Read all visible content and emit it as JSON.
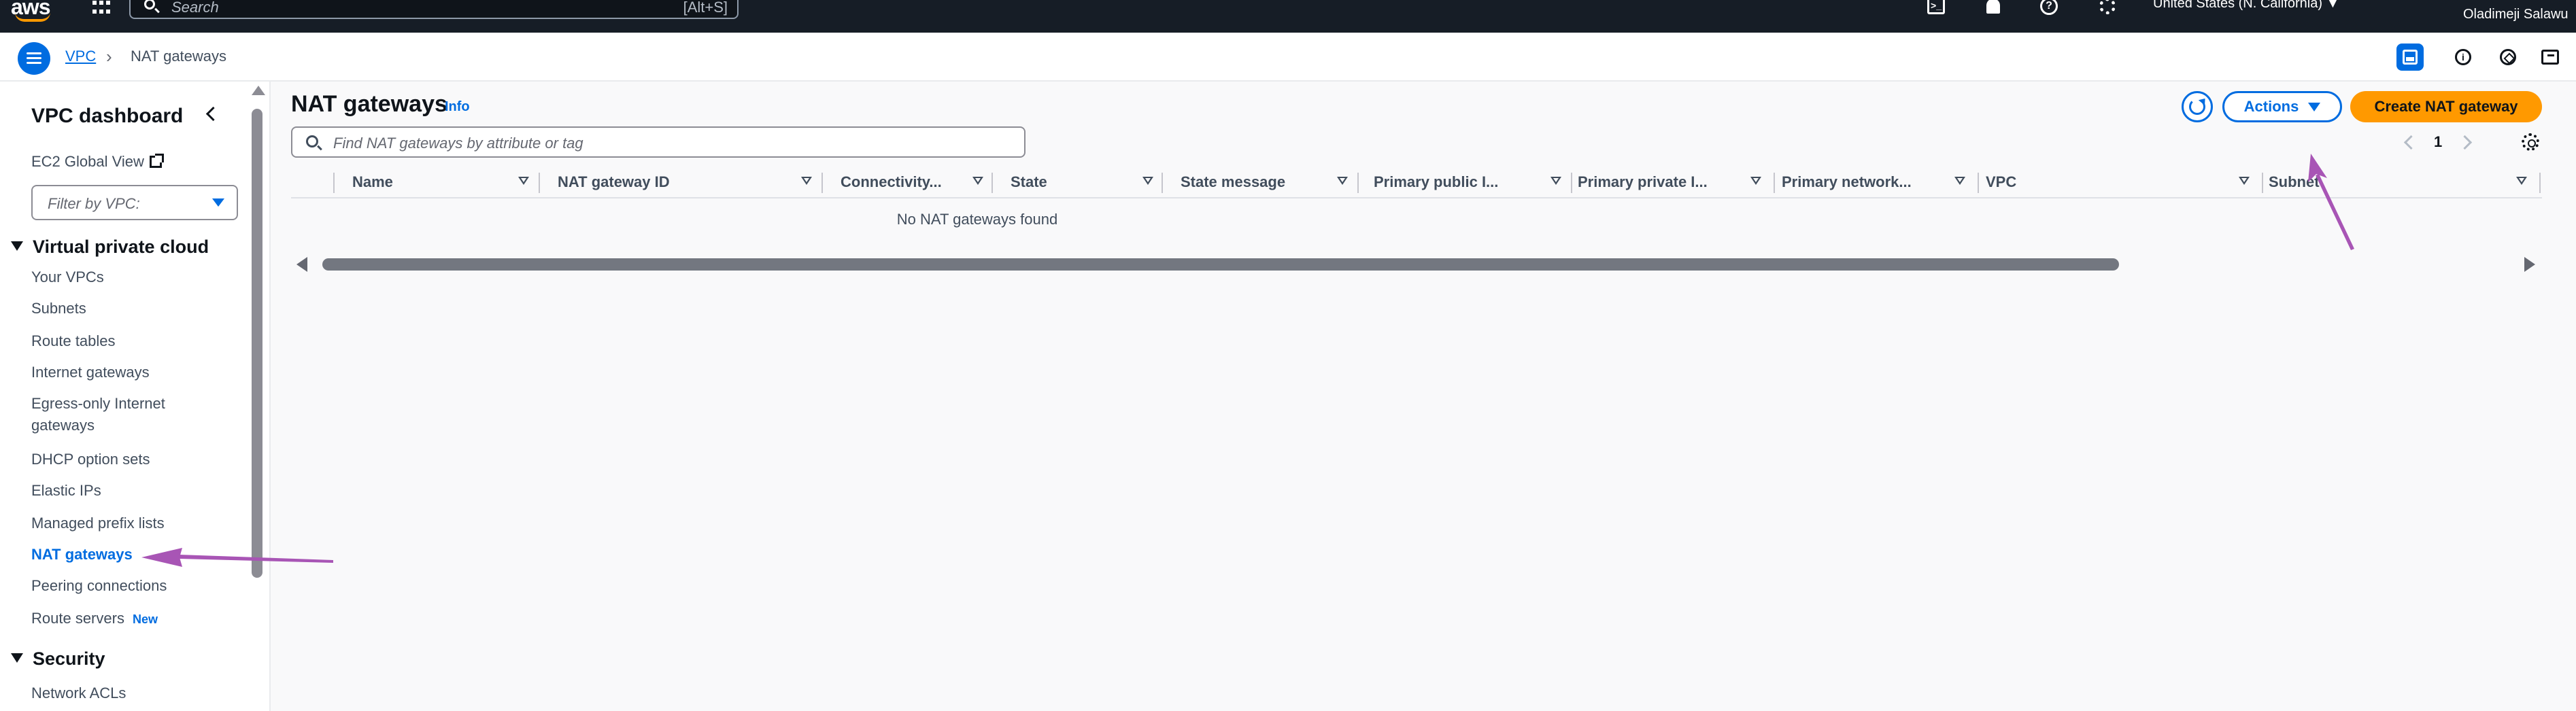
{
  "topbar": {
    "logo_text": "aws",
    "search_placeholder": "Search",
    "search_shortcut": "[Alt+S]",
    "cloudshell_label": ">_",
    "help_label": "?",
    "region": "United States (N. California) ▼",
    "user": "Oladimeji Salawu"
  },
  "breadcrumb": {
    "root": "VPC",
    "separator": "›",
    "current": "NAT gateways"
  },
  "utility": {
    "info_label": "i"
  },
  "sidebar": {
    "title": "VPC dashboard",
    "ec2_global_view": "EC2 Global View",
    "filter_placeholder": "Filter by VPC:",
    "sections": [
      {
        "title": "Virtual private cloud",
        "items": [
          {
            "label": "Your VPCs"
          },
          {
            "label": "Subnets"
          },
          {
            "label": "Route tables"
          },
          {
            "label": "Internet gateways"
          },
          {
            "label": "Egress-only Internet gateways"
          },
          {
            "label": "DHCP option sets"
          },
          {
            "label": "Elastic IPs"
          },
          {
            "label": "Managed prefix lists"
          },
          {
            "label": "NAT gateways",
            "active": true
          },
          {
            "label": "Peering connections"
          },
          {
            "label": "Route servers",
            "badge": "New"
          }
        ]
      },
      {
        "title": "Security",
        "items": [
          {
            "label": "Network ACLs"
          }
        ]
      }
    ]
  },
  "main": {
    "title": "NAT gateways",
    "info_link": "Info",
    "actions_label": "Actions",
    "create_label": "Create NAT gateway",
    "search_placeholder": "Find NAT gateways by attribute or tag",
    "page_number": "1",
    "columns": [
      {
        "label": "Name"
      },
      {
        "label": "NAT gateway ID"
      },
      {
        "label": "Connectivity..."
      },
      {
        "label": "State"
      },
      {
        "label": "State message"
      },
      {
        "label": "Primary public I..."
      },
      {
        "label": "Primary private I..."
      },
      {
        "label": "Primary network..."
      },
      {
        "label": "VPC"
      },
      {
        "label": "Subnet"
      }
    ],
    "rows": [],
    "empty_message": "No NAT gateways found"
  },
  "colors": {
    "topbar_bg": "#161d26",
    "link_blue": "#006ce0",
    "primary_button": "#ff9900",
    "annotation_arrow": "#a855b5"
  }
}
